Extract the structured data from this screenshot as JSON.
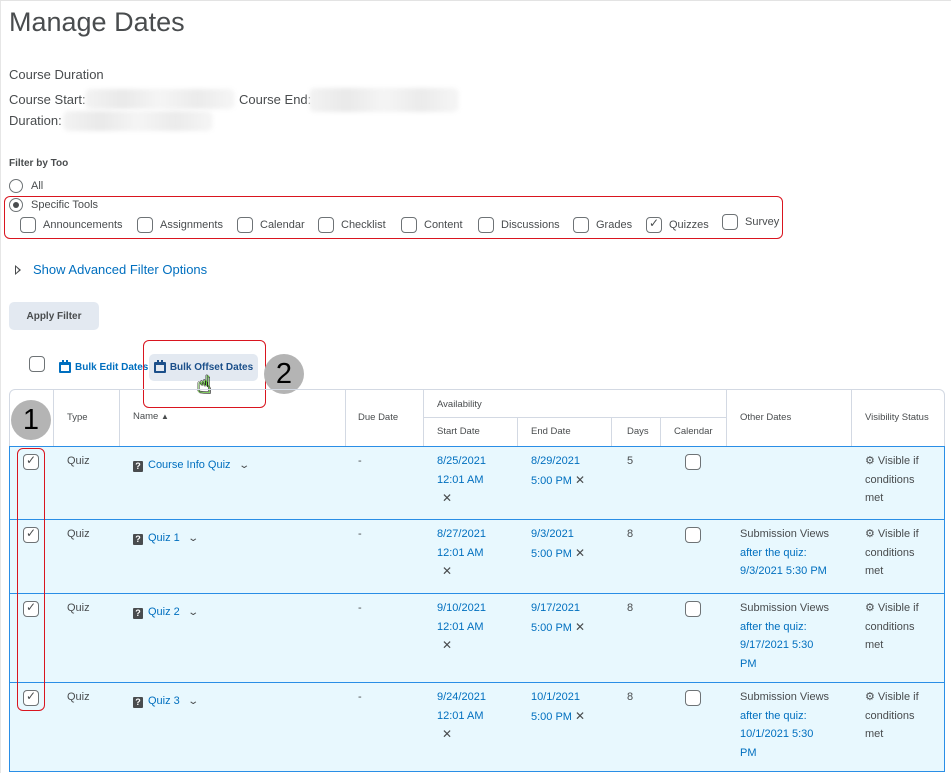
{
  "page": {
    "title": "Manage Dates",
    "course_duration_heading": "Course Duration",
    "course_start_label": "Course Start:",
    "course_end_label": "Course End:",
    "duration_label": "Duration:"
  },
  "filter": {
    "label": "Filter by Too",
    "options": [
      {
        "label": "All",
        "selected": false
      },
      {
        "label": "Specific Tools",
        "selected": true
      }
    ],
    "tools": [
      {
        "label": "Announcements",
        "checked": false
      },
      {
        "label": "Assignments",
        "checked": false
      },
      {
        "label": "Calendar",
        "checked": false
      },
      {
        "label": "Checklist",
        "checked": false
      },
      {
        "label": "Content",
        "checked": false
      },
      {
        "label": "Discussions",
        "checked": false
      },
      {
        "label": "Grades",
        "checked": false
      },
      {
        "label": "Quizzes",
        "checked": true
      },
      {
        "label": "Survey",
        "checked": false
      }
    ],
    "advanced_link": "Show Advanced Filter Options",
    "apply_button": "Apply Filter"
  },
  "toolbar": {
    "bulk_edit": "Bulk Edit Dates",
    "bulk_offset": "Bulk Offset Dates"
  },
  "callouts": {
    "one": "1",
    "two": "2"
  },
  "table": {
    "headers": {
      "type": "Type",
      "name": "Name",
      "due_date": "Due Date",
      "availability": "Availability",
      "start_date": "Start Date",
      "end_date": "End Date",
      "days": "Days",
      "calendar": "Calendar",
      "other_dates": "Other Dates",
      "visibility": "Visibility Status"
    },
    "rows": [
      {
        "selected": true,
        "type": "Quiz",
        "name": "Course Info Quiz",
        "due": "-",
        "start_date": "8/25/2021",
        "start_time": "12:01 AM",
        "end_date": "8/29/2021",
        "end_time": "5:00 PM",
        "days": "5",
        "calendar": false,
        "other_label": "",
        "other_link_1": "",
        "other_link_2": "",
        "other_link_3": "",
        "vis_1": "Visible if",
        "vis_2": "conditions",
        "vis_3": "met"
      },
      {
        "selected": true,
        "type": "Quiz",
        "name": "Quiz 1",
        "due": "-",
        "start_date": "8/27/2021",
        "start_time": "12:01 AM",
        "end_date": "9/3/2021",
        "end_time": "5:00 PM",
        "days": "8",
        "calendar": false,
        "other_label": "Submission Views",
        "other_link_1": "after the quiz:",
        "other_link_2": "9/3/2021 5:30 PM",
        "other_link_3": "",
        "vis_1": "Visible if",
        "vis_2": "conditions",
        "vis_3": "met"
      },
      {
        "selected": true,
        "type": "Quiz",
        "name": "Quiz 2",
        "due": "-",
        "start_date": "9/10/2021",
        "start_time": "12:01 AM",
        "end_date": "9/17/2021",
        "end_time": "5:00 PM",
        "days": "8",
        "calendar": false,
        "other_label": "Submission Views",
        "other_link_1": "after the quiz:",
        "other_link_2": "9/17/2021 5:30",
        "other_link_3": "PM",
        "vis_1": "Visible if",
        "vis_2": "conditions",
        "vis_3": "met"
      },
      {
        "selected": true,
        "type": "Quiz",
        "name": "Quiz 3",
        "due": "-",
        "start_date": "9/24/2021",
        "start_time": "12:01 AM",
        "end_date": "10/1/2021",
        "end_time": "5:00 PM",
        "days": "8",
        "calendar": false,
        "other_label": "Submission Views",
        "other_link_1": "after the quiz:",
        "other_link_2": "10/1/2021 5:30",
        "other_link_3": "PM",
        "vis_1": "Visible if",
        "vis_2": "conditions",
        "vis_3": "met"
      }
    ]
  },
  "icons": {
    "remove": "✕",
    "sort_asc": "▲",
    "chevron": "⌄",
    "quiz": "?"
  }
}
